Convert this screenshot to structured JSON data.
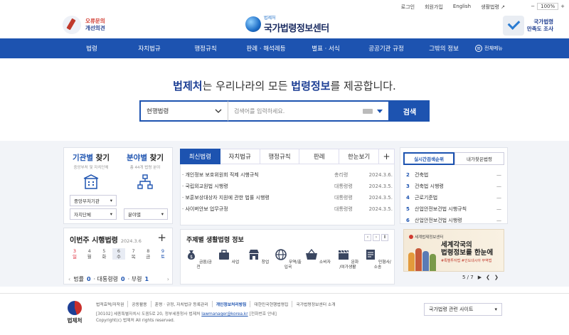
{
  "top": {
    "links": [
      "로그인",
      "회원가입",
      "English",
      "생활법령"
    ],
    "zoom": "100%",
    "zoom_minus": "−",
    "zoom_plus": "+"
  },
  "logo_left": {
    "line1": "오류문의",
    "line2": "개선의견"
  },
  "brand": {
    "small": "법제처",
    "name": "국가법령정보센터"
  },
  "logo_right": {
    "line1": "국가법령",
    "line2": "만족도 조사"
  },
  "nav": {
    "items": [
      "법령",
      "자치법규",
      "행정규칙",
      "판례 · 해석례등",
      "별표 · 서식",
      "공공기관 규정",
      "그밖의 정보"
    ],
    "all_menu": "전체메뉴",
    "all_menu_icon": "≡"
  },
  "hero": {
    "p1": "법제처",
    "p2": "는 우리나라의 모든 ",
    "p3": "법령정보",
    "p4": "를 제공합니다."
  },
  "search": {
    "category": "현행법령",
    "placeholder": "검색어를 입력하세요.",
    "button": "검색"
  },
  "agency": {
    "title_a": "기관별",
    "title_b": " 찾기",
    "sub": "중앙부처 및 자치단체",
    "dd1": "중앙부처기관",
    "dd2": "자치단체"
  },
  "field": {
    "title_a": "분야별",
    "title_b": " 찾기",
    "sub": "총 44개 법령 분야",
    "dd": "분야별"
  },
  "week": {
    "title": "이번주 시행법령",
    "date": "2024.3.6",
    "plus": "+",
    "days": [
      {
        "n": "3",
        "w": "일"
      },
      {
        "n": "4",
        "w": "월"
      },
      {
        "n": "5",
        "w": "화"
      },
      {
        "n": "6",
        "w": "수"
      },
      {
        "n": "7",
        "w": "목"
      },
      {
        "n": "8",
        "w": "금"
      },
      {
        "n": "9",
        "w": "토"
      }
    ],
    "law_label": "법률",
    "law_count": "0",
    "decree_label": "· 대통령령",
    "decree_count": "0",
    "ord_label": "· 부령",
    "ord_count": "1"
  },
  "tabs": [
    "최신법령",
    "자치법규",
    "행정규칙",
    "판례",
    "한눈보기",
    "+"
  ],
  "news": [
    {
      "title": "개인정보 보호위원회 직제 시행규칙",
      "agency": "총리령",
      "date": "2024.3.6."
    },
    {
      "title": "국립외교원법 시행령",
      "agency": "대통령령",
      "date": "2024.3.5."
    },
    {
      "title": "보훈보상대상자 지원에 관한 법률 시행령",
      "agency": "대통령령",
      "date": "2024.3.5."
    },
    {
      "title": "사이버안보 업무규정",
      "agency": "대통령령",
      "date": "2024.3.5."
    }
  ],
  "life": {
    "title": "주제별 생활법령 정보",
    "ctl": [
      "‹",
      "›",
      "Ⅱ"
    ],
    "items": [
      {
        "label": "금융/금전",
        "icon": "money-bag-icon"
      },
      {
        "label": "사업",
        "icon": "briefcase-icon"
      },
      {
        "label": "창업",
        "icon": "store-icon"
      },
      {
        "label": "무역/출입국",
        "icon": "globe-icon"
      },
      {
        "label": "소비자",
        "icon": "basket-icon"
      },
      {
        "label": "문화\n/여가생활",
        "icon": "clapper-icon"
      },
      {
        "label": "민형사/소송",
        "icon": "document-icon"
      }
    ]
  },
  "rank": {
    "tab_active": "실시간검색순위",
    "tab_other": "내가찾은법령",
    "items": [
      {
        "n": "2",
        "t": "건축법",
        "m": "—"
      },
      {
        "n": "3",
        "t": "건축법 시행령",
        "m": "—"
      },
      {
        "n": "4",
        "t": "근로기준법",
        "m": "—"
      },
      {
        "n": "5",
        "t": "산업안전보건법 시행규칙",
        "m": "—"
      },
      {
        "n": "6",
        "t": "산업안전보건법 시행령",
        "m": "—"
      }
    ]
  },
  "banner": {
    "tag": "세계법제정보센터",
    "line1": "세계각국의",
    "line2": "법령정보를 한눈에",
    "sub": "#특별투자법 #인도네시아 무역법",
    "page": "5 / 7",
    "play": "▶",
    "prev": "❮",
    "next": "❯"
  },
  "footer": {
    "org": "법제처",
    "links": [
      "법적효력/저작권",
      "공동활용",
      "훈령 · 규정, 자치법규 등록관리",
      "개인정보처리방침",
      "대한민국현행법령집",
      "국가법령정보센터 소개"
    ],
    "addr_pre": "[30102] 세종특별자치시 도움5로 20, 정부세종청사 법제처 ",
    "email": "lawmanager@korea.kr",
    "addr_post": " [전화번호 안내]",
    "copyright": "Copyright(c) 법제처 All rights reserved.",
    "site_select": "국가법령 관련 사이트"
  },
  "colors": {
    "primary": "#1d53b0",
    "navy": "#1d3f95",
    "accent_red": "#d03a2f"
  }
}
